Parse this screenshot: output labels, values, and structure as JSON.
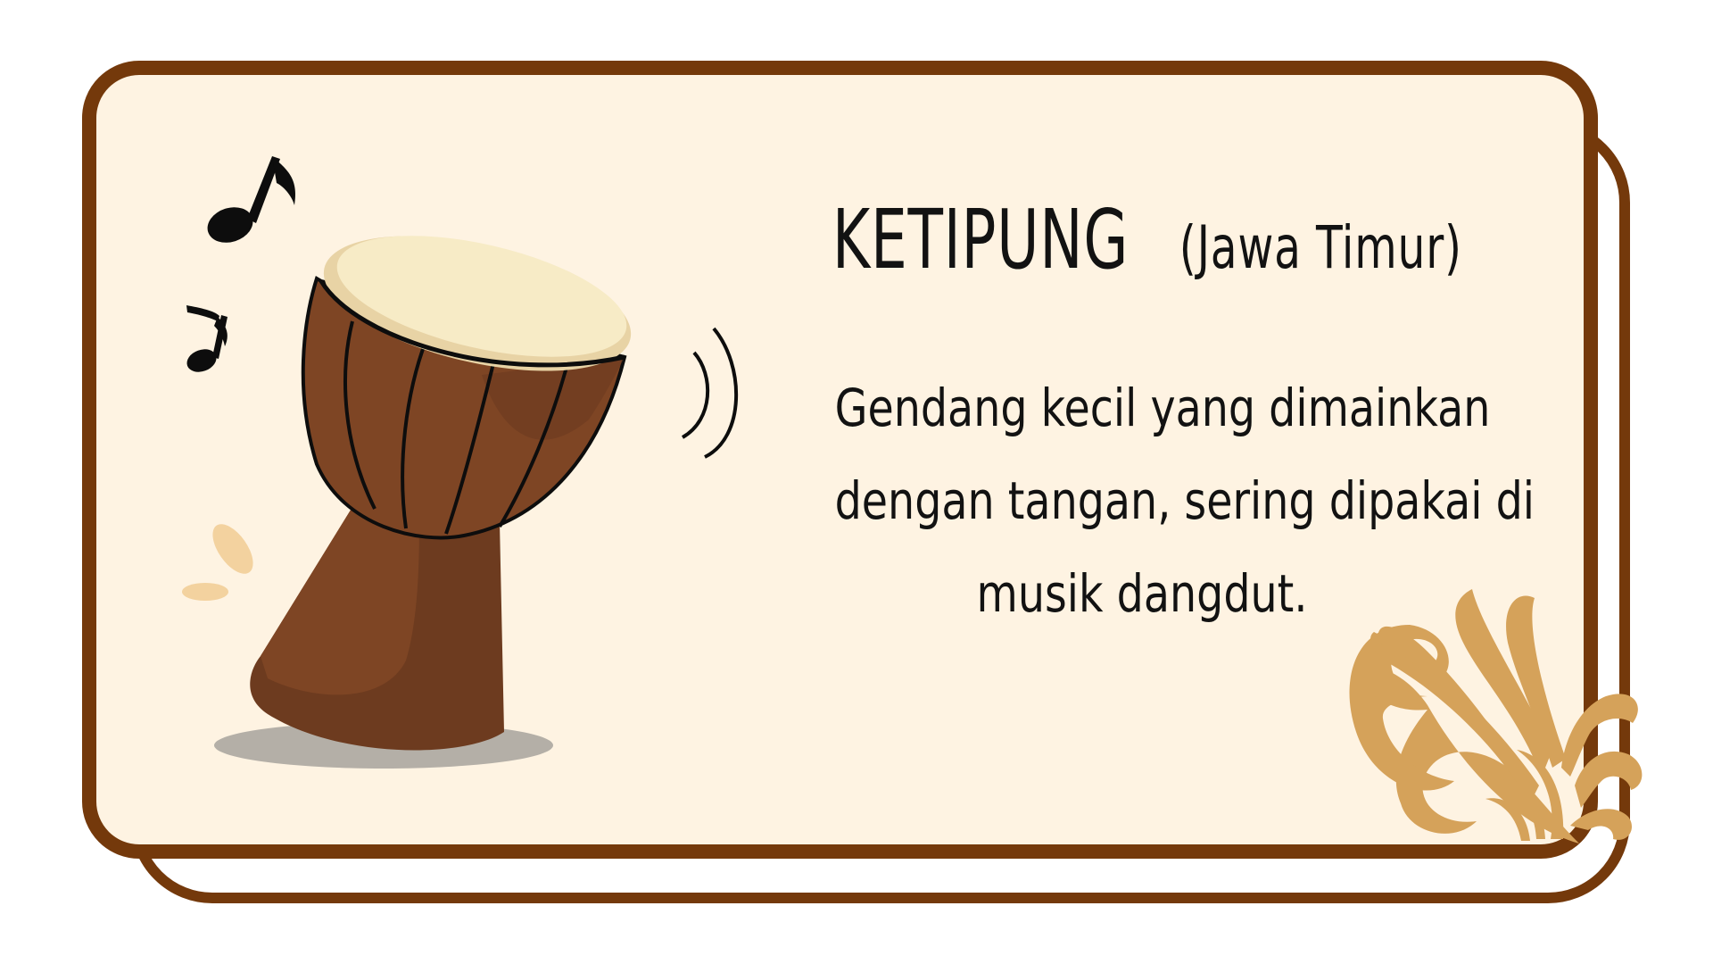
{
  "card": {
    "title": "KETIPUNG",
    "region": "(Jawa Timur)",
    "description_lines": [
      "Gendang kecil yang dimainkan",
      "dengan tangan, sering dipakai di",
      "musik dangdut."
    ]
  },
  "colors": {
    "frame": "#74390b",
    "card_background": "#fef3e2",
    "drum_body": "#7e4524",
    "drum_head": "#f5e7c2",
    "ornament": "#d5a25a",
    "text": "#121212"
  },
  "icons": [
    "music-notes-icon",
    "drum-illustration",
    "sound-waves-icon",
    "floral-ornament"
  ]
}
